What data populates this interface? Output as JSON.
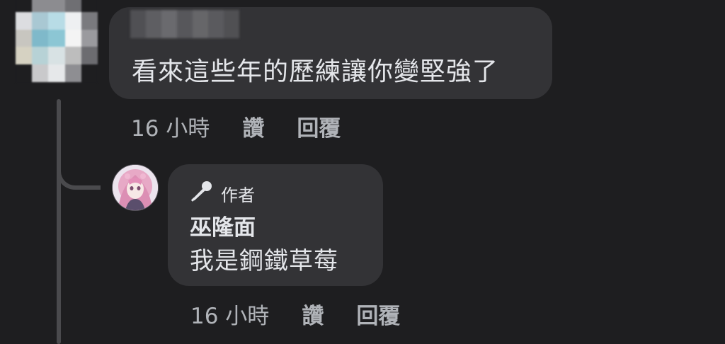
{
  "comment": {
    "text": "看來這些年的歷練讓你變堅強了",
    "time": "16 小時",
    "like_label": "讚",
    "reply_label": "回覆"
  },
  "reply": {
    "badge_label": "作者",
    "badge_icon": "microphone-icon",
    "author_name": "巫隆面",
    "text": "我是鋼鐵草莓",
    "time": "16 小時",
    "like_label": "讚",
    "reply_label": "回覆"
  },
  "colors": {
    "background": "#1e1e20",
    "bubble": "#333336",
    "primary_text": "#e4e6ea",
    "secondary_text": "#b0b3b8",
    "thread_line": "#4a4a4d"
  }
}
